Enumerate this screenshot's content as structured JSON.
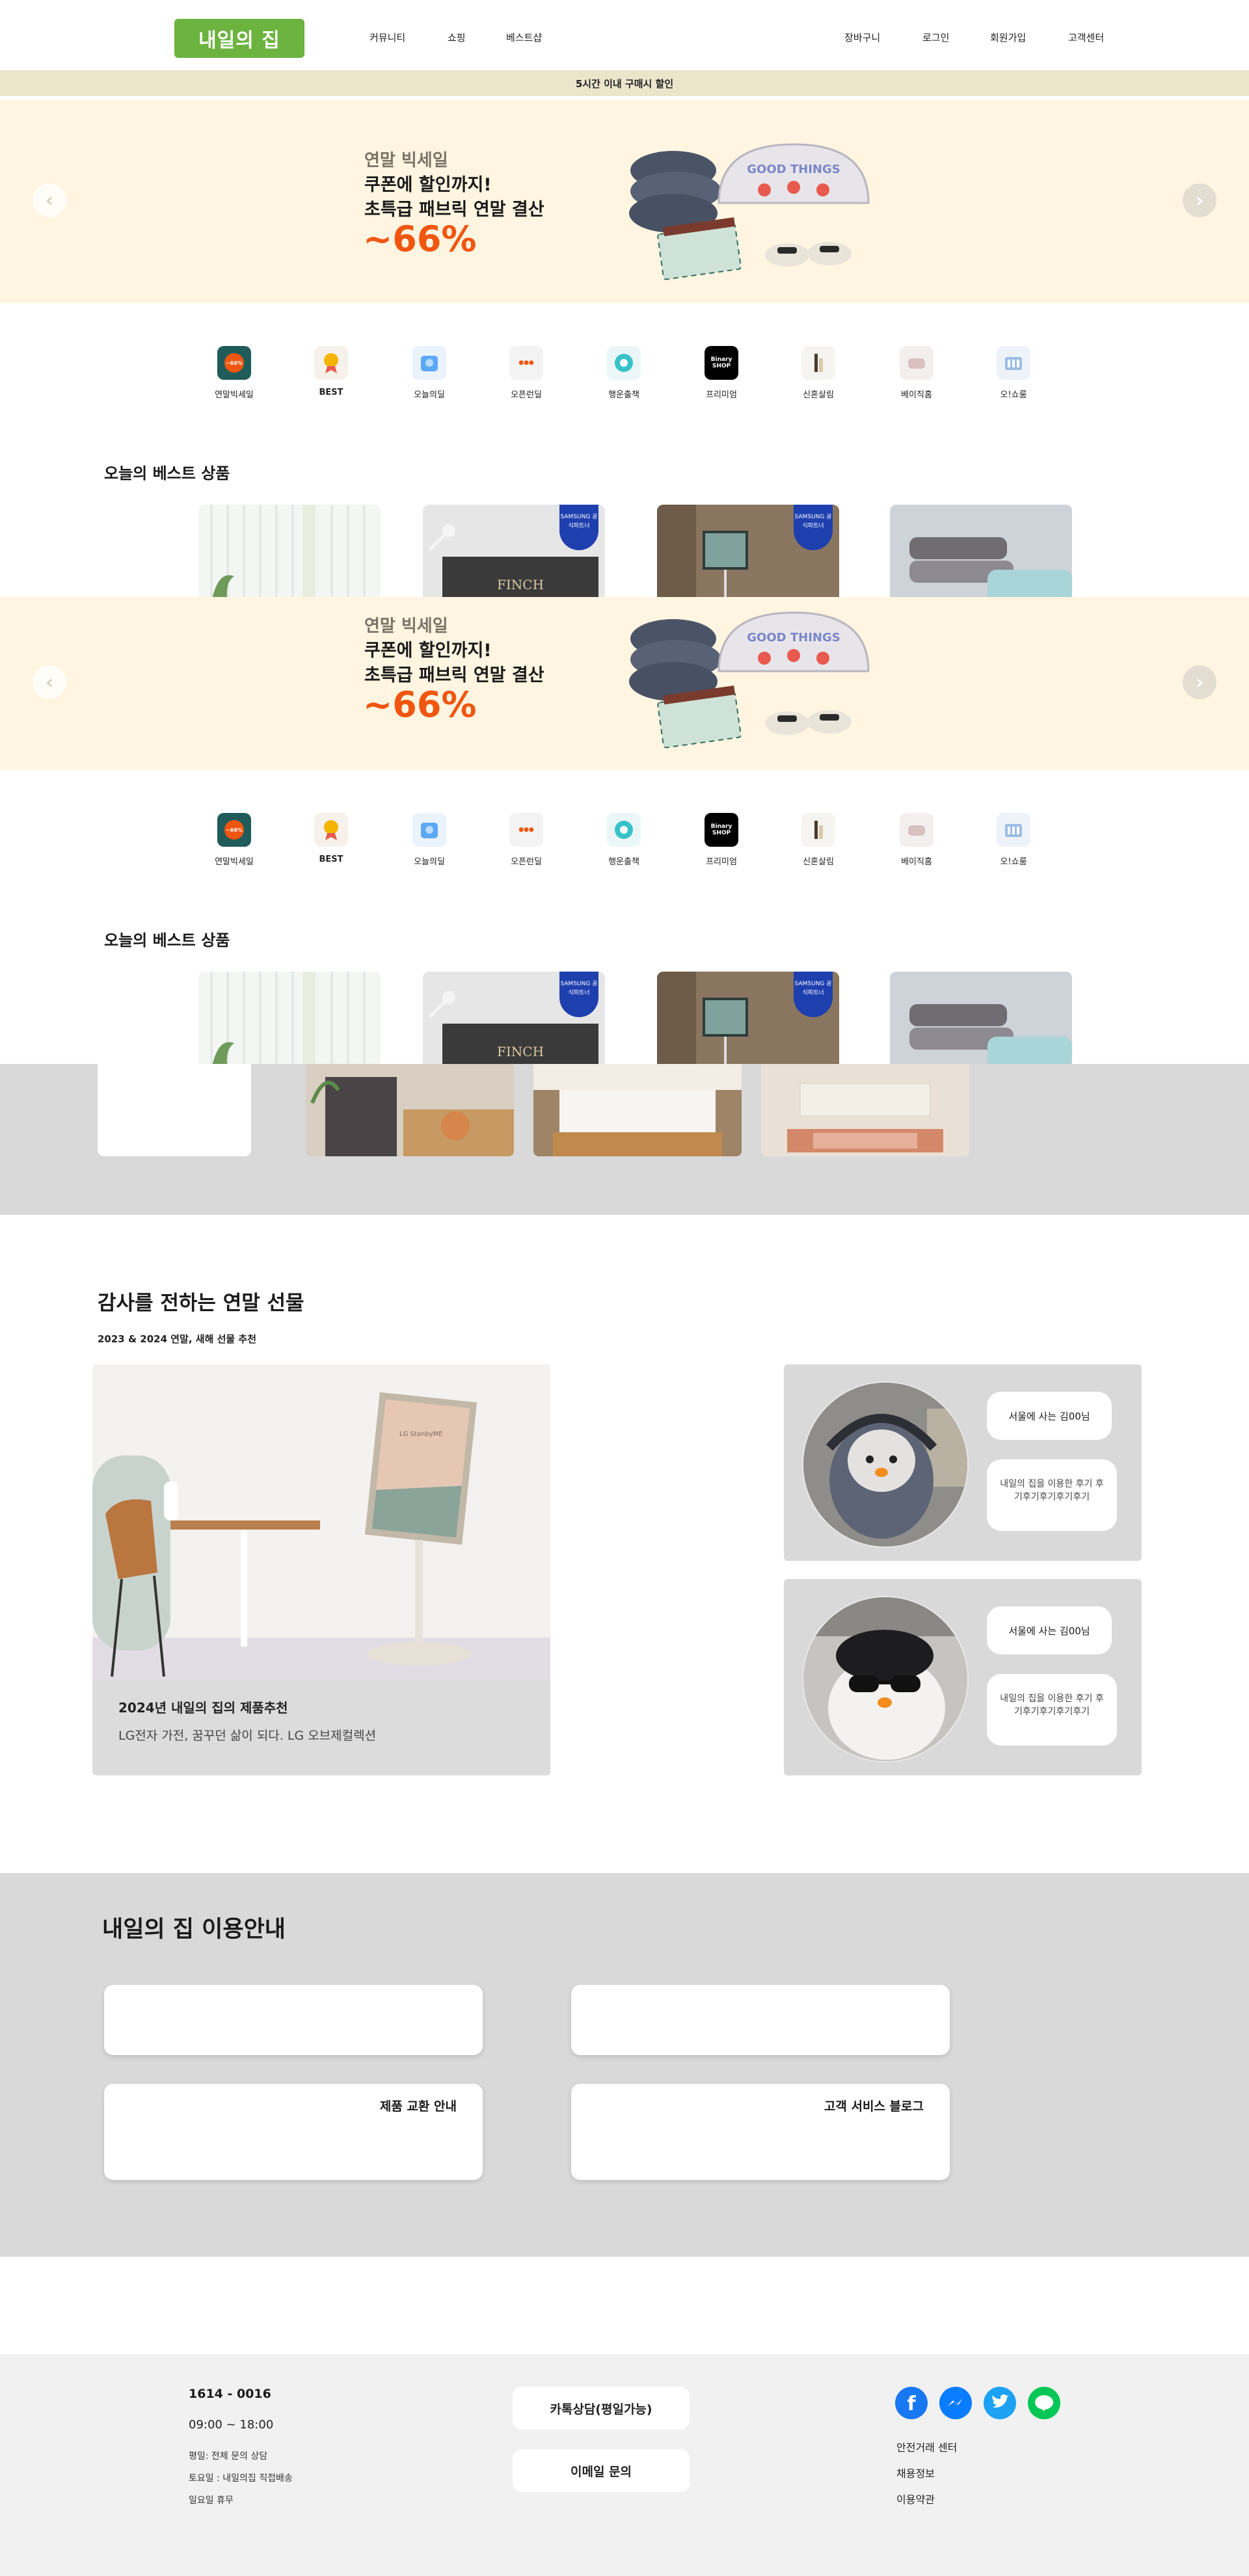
{
  "header": {
    "logo": "내일의 집",
    "nav_left": [
      "커뮤니티",
      "쇼핑",
      "베스트샵"
    ],
    "nav_right": [
      "장바구니",
      "로그인",
      "회원가입",
      "고객센터"
    ]
  },
  "promo_strip": "5시간 이내 구매시 할인",
  "banner": {
    "eyebrow": "연말 빅세일",
    "headline_1": "쿠폰에 할인까지!",
    "headline_2": "초특급 패브릭 연말 결산",
    "percent": "~66%",
    "art_text": "GOOD THINGS"
  },
  "categories": [
    "연말빅세일",
    "BEST",
    "오늘의딜",
    "오픈런딜",
    "행운출책",
    "프리미엄",
    "신혼살림",
    "베이직홈",
    "오!쇼룸"
  ],
  "category_icon_texts": {
    "sale": "~66%",
    "premium": "Binary SHOP"
  },
  "best_section": {
    "title": "오늘의 베스트 상품",
    "badge": "SAMSUNG 공식파트너",
    "tv_caption": "FINCH"
  },
  "gift": {
    "title": "감사를 전하는 연말 선물",
    "subtitle": "2023 & 2024 연말, 새해 선물 추천",
    "card_title": "2024년 내일의 집의 제품추천",
    "card_desc": "LG전자 가전, 꿈꾸던 삶이 되다. LG 오브제컬렉션",
    "stand_screen": "LG StanbyME",
    "reviews": [
      {
        "name": "서울에 사는 김00님",
        "text": "내일의 집을 이용한 후기 후기후기후기후기후기"
      },
      {
        "name": "서울에 사는 김00님",
        "text": "내일의 집을 이용한 후기 후기후기후기후기후기"
      }
    ]
  },
  "guide": {
    "title": "내일의 집 이용안내",
    "cards": [
      "",
      "",
      "제품 교환 안내",
      "고객 서비스 블로그"
    ]
  },
  "footer": {
    "phone": "1614 - 0016",
    "hours": "09:00 ~ 18:00",
    "lines": [
      "평일: 전체 문의 상담",
      "토요일 : 내일의집 직접배송",
      "일요일 휴무"
    ],
    "buttons": [
      "카톡상담(평일가능)",
      "이메일 문의"
    ],
    "social_icons": [
      "facebook-icon",
      "messenger-icon",
      "twitter-icon",
      "line-icon"
    ],
    "social_colors": [
      "#1877f2",
      "#0a7cff",
      "#1da1f2",
      "#06c755"
    ],
    "links": [
      "안전거래 센터",
      "채용정보",
      "이용약관"
    ]
  },
  "colors": {
    "brand": "#6db33f",
    "promo_strip": "#ebe5cc",
    "banner_bg": "#fff5e1",
    "accent": "#f0560f",
    "band": "#d9d9d9"
  }
}
